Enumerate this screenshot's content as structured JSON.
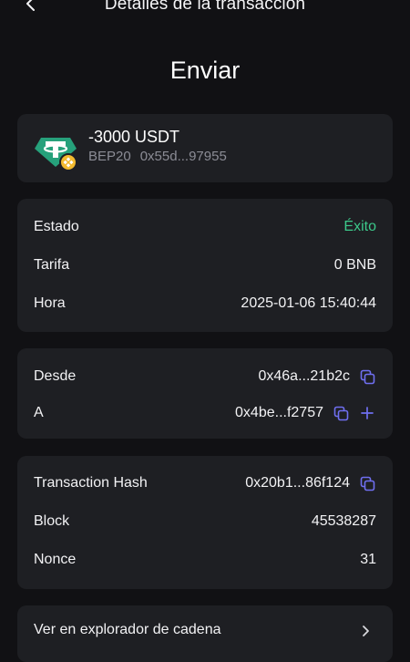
{
  "header": {
    "title": "Detalles de la transacción",
    "back_icon": "back-chevron-icon"
  },
  "page_title": "Enviar",
  "asset": {
    "amount": "-3000 USDT",
    "network": "BEP20",
    "address": "0x55d...97955",
    "logo": "tether-logo",
    "network_badge": "bnb-badge-icon",
    "colors": {
      "tether": "#26a17b",
      "bnb": "#f3ba2f"
    }
  },
  "status": {
    "state_label": "Estado",
    "state_value": "Éxito",
    "fee_label": "Tarifa",
    "fee_value": "0 BNB",
    "time_label": "Hora",
    "time_value": "2025-01-06 15:40:44",
    "success_color": "#3cc88a"
  },
  "addresses": {
    "from_label": "Desde",
    "from_value": "0x46a...21b2c",
    "to_label": "A",
    "to_value": "0x4be...f2757",
    "copy_icon": "copy-icon",
    "add_icon": "add-contact-icon",
    "accent": "#6f6ff0"
  },
  "chain": {
    "hash_label": "Transaction Hash",
    "hash_value": "0x20b1...86f124",
    "block_label": "Block",
    "block_value": "45538287",
    "nonce_label": "Nonce",
    "nonce_value": "31"
  },
  "explorer": {
    "label": "Ver en explorador de cadena",
    "chevron_icon": "chevron-right-icon"
  }
}
